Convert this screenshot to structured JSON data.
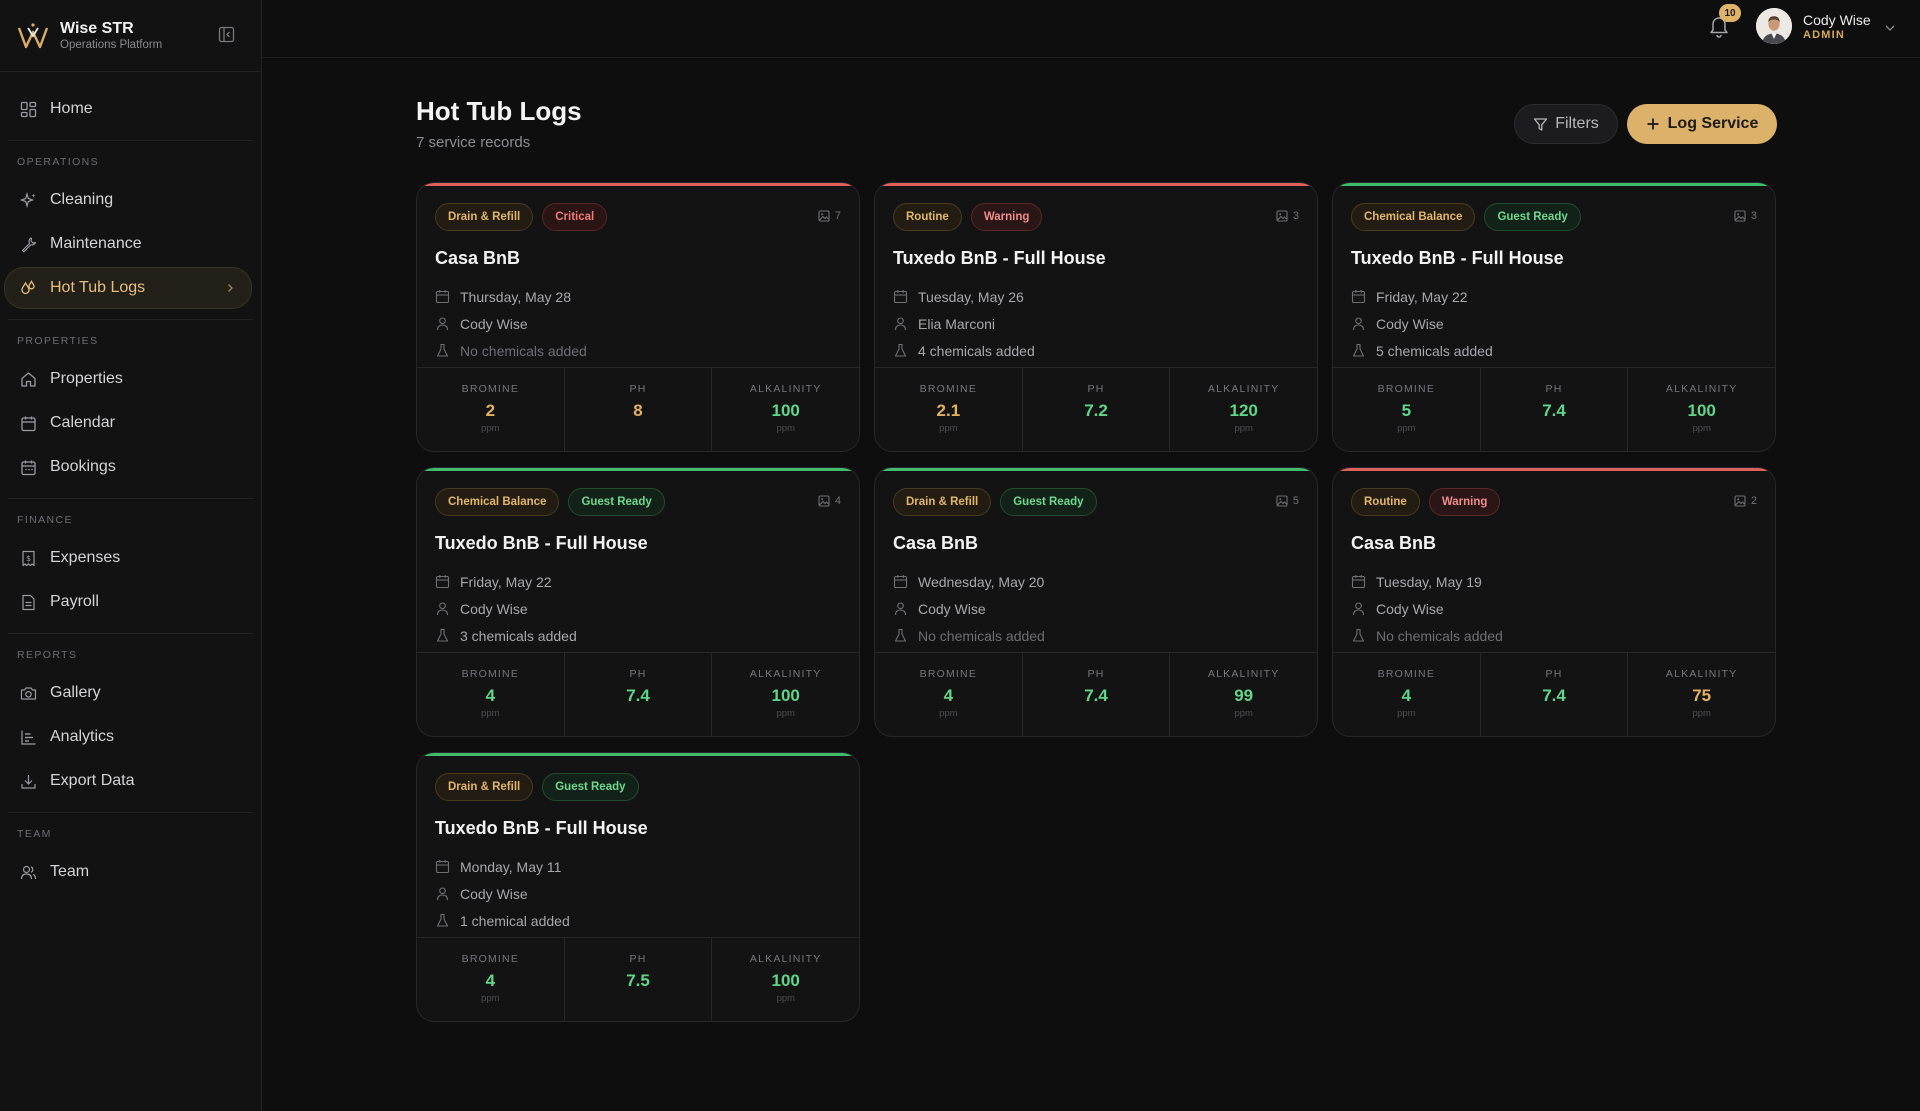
{
  "brand": {
    "name": "Wise STR",
    "subtitle": "Operations Platform"
  },
  "nav": {
    "home": "Home",
    "sections": {
      "operations": "OPERATIONS",
      "properties": "PROPERTIES",
      "finance": "FINANCE",
      "reports": "REPORTS",
      "team": "TEAM"
    },
    "items": {
      "cleaning": "Cleaning",
      "maintenance": "Maintenance",
      "hot_tub_logs": "Hot Tub Logs",
      "properties": "Properties",
      "calendar": "Calendar",
      "bookings": "Bookings",
      "expenses": "Expenses",
      "payroll": "Payroll",
      "gallery": "Gallery",
      "analytics": "Analytics",
      "export_data": "Export Data",
      "team": "Team"
    }
  },
  "header": {
    "notifications_count": "10",
    "user_name": "Cody Wise",
    "user_role": "ADMIN"
  },
  "page": {
    "title": "Hot Tub Logs",
    "subtitle": "7 service records",
    "filters_label": "Filters",
    "log_service_label": "Log Service"
  },
  "stat_labels": {
    "bromine": "BROMINE",
    "ph": "PH",
    "alkalinity": "ALKALINITY",
    "unit": "ppm"
  },
  "colors": {
    "accent": "#dcb16a",
    "critical": "#f07a7a",
    "ready": "#5fd68a",
    "card_bg": "#131314"
  },
  "cards": [
    {
      "type": "Drain & Refill",
      "status": "Critical",
      "photos": "7",
      "property": "Casa BnB",
      "date": "Thursday, May 28",
      "tech": "Cody Wise",
      "chemicals": "No chemicals added",
      "bromine": "2",
      "ph": "8",
      "alkalinity": "100"
    },
    {
      "type": "Routine",
      "status": "Warning",
      "photos": "3",
      "property": "Tuxedo BnB - Full House",
      "date": "Tuesday, May 26",
      "tech": "Elia Marconi",
      "chemicals": "4 chemicals added",
      "bromine": "2.1",
      "ph": "7.2",
      "alkalinity": "120"
    },
    {
      "type": "Chemical Balance",
      "status": "Guest Ready",
      "photos": "3",
      "property": "Tuxedo BnB - Full House",
      "date": "Friday, May 22",
      "tech": "Cody Wise",
      "chemicals": "5 chemicals added",
      "bromine": "5",
      "ph": "7.4",
      "alkalinity": "100"
    },
    {
      "type": "Chemical Balance",
      "status": "Guest Ready",
      "photos": "4",
      "property": "Tuxedo BnB - Full House",
      "date": "Friday, May 22",
      "tech": "Cody Wise",
      "chemicals": "3 chemicals added",
      "bromine": "4",
      "ph": "7.4",
      "alkalinity": "100"
    },
    {
      "type": "Drain & Refill",
      "status": "Guest Ready",
      "photos": "5",
      "property": "Casa BnB",
      "date": "Wednesday, May 20",
      "tech": "Cody Wise",
      "chemicals": "No chemicals added",
      "bromine": "4",
      "ph": "7.4",
      "alkalinity": "99"
    },
    {
      "type": "Routine",
      "status": "Warning",
      "photos": "2",
      "property": "Casa BnB",
      "date": "Tuesday, May 19",
      "tech": "Cody Wise",
      "chemicals": "No chemicals added",
      "bromine": "4",
      "ph": "7.4",
      "alkalinity": "75"
    },
    {
      "type": "Drain & Refill",
      "status": "Guest Ready",
      "photos": "",
      "property": "Tuxedo BnB - Full House",
      "date": "Monday, May 11",
      "tech": "Cody Wise",
      "chemicals": "1 chemical added",
      "bromine": "4",
      "ph": "7.5",
      "alkalinity": "100"
    }
  ]
}
